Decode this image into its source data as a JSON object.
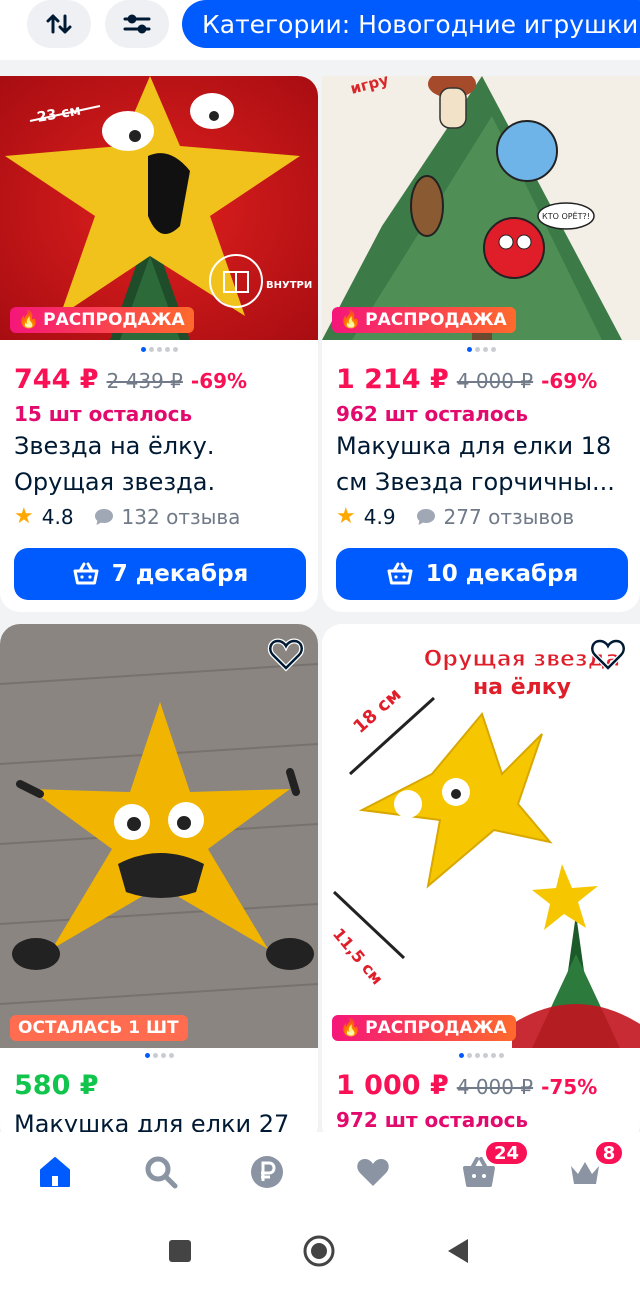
{
  "toolbar": {
    "sort_icon": "sort-arrows-icon",
    "filter_icon": "filter-sliders-icon",
    "category_chip": "Категории: Новогодние игрушки"
  },
  "products": [
    {
      "badge": "РАСПРОДАЖА",
      "badge_type": "sale",
      "image_text": {
        "size": "23 см",
        "inside": "ВНУТРИ"
      },
      "price": "744 ₽",
      "old_price": "2 439 ₽",
      "discount": "-69%",
      "stock": "15 шт осталось",
      "title": "Звезда на ёлку. Орущая звезда.",
      "rating": "4.8",
      "reviews": "132 отзыва",
      "delivery": "7 декабря"
    },
    {
      "badge": "РАСПРОДАЖА",
      "badge_type": "sale",
      "image_text": {
        "bubble": "КТО ОРЁТ?!",
        "corner": "игру"
      },
      "price": "1 214 ₽",
      "old_price": "4 000 ₽",
      "discount": "-69%",
      "stock": "962 шт осталось",
      "title": "Макушка для елки 18 см Звезда горчичны...",
      "rating": "4.9",
      "reviews": "277 отзывов",
      "delivery": "10 декабря"
    },
    {
      "badge": "ОСТАЛАСЬ 1 ШТ",
      "badge_type": "left",
      "price": "580 ₽",
      "title": "Макушка для елки 27"
    },
    {
      "badge": "РАСПРОДАЖА",
      "badge_type": "sale",
      "image_text": {
        "headline_1": "Орущая звезда",
        "headline_2": "на ёлку",
        "size_1": "18 см",
        "size_2": "11,5 см"
      },
      "price": "1 000 ₽",
      "old_price": "4 000 ₽",
      "discount": "-75%",
      "stock": "972 шт осталось"
    }
  ],
  "bottom_nav": {
    "items": [
      "home-icon",
      "search-icon",
      "ruble-icon",
      "favorites-icon",
      "cart-icon",
      "profile-crown-icon"
    ],
    "cart_count": "24",
    "profile_count": "8"
  },
  "colors": {
    "accent": "#005bff",
    "price_pink": "#f91155",
    "price_green": "#10c44c",
    "background": "#f2f3f5"
  }
}
